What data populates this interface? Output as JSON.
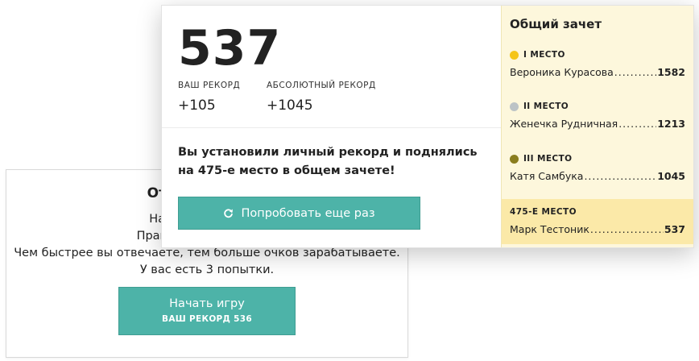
{
  "intro": {
    "title": "Отвечайте на в",
    "lines": [
      "На каждый вопрос",
      "Правильный ответ обн",
      "Чем быстрее вы отвечаете, тем больше очков зарабатываете.",
      "У вас есть 3 попытки."
    ],
    "start_button": {
      "label": "Начать игру",
      "sublabel": "ВАШ РЕКОРД 536"
    }
  },
  "result": {
    "score": "537",
    "personal_record": {
      "caption": "ВАШ РЕКОРД",
      "value": "+105"
    },
    "absolute_record": {
      "caption": "АБСОЛЮТНЫЙ РЕКОРД",
      "value": "+1045"
    },
    "message_line1": "Вы установили личный рекорд и поднялись",
    "message_line2": "на 475-е место в общем зачете!",
    "retry_button": {
      "label": "Попробовать еще раз",
      "icon": "refresh-icon"
    }
  },
  "leaderboard": {
    "title": "Общий зачет",
    "places": [
      {
        "place": "I МЕСТО",
        "name": "Вероника Курасова",
        "points": "1582",
        "medal_color": "#f5c518"
      },
      {
        "place": "II МЕСТО",
        "name": "Женечка Рудничная",
        "points": "1213",
        "medal_color": "#bcc3c6"
      },
      {
        "place": "III МЕСТО",
        "name": "Катя Самбука",
        "points": "1045",
        "medal_color": "#8a7d1e"
      }
    ],
    "current": {
      "place": "475-Е МЕСТО",
      "name": "Марк Тестоник",
      "points": "537"
    }
  },
  "colors": {
    "accent": "#4db3a8",
    "board_bg": "#fdf7dc",
    "board_highlight": "#fbe9a8"
  }
}
